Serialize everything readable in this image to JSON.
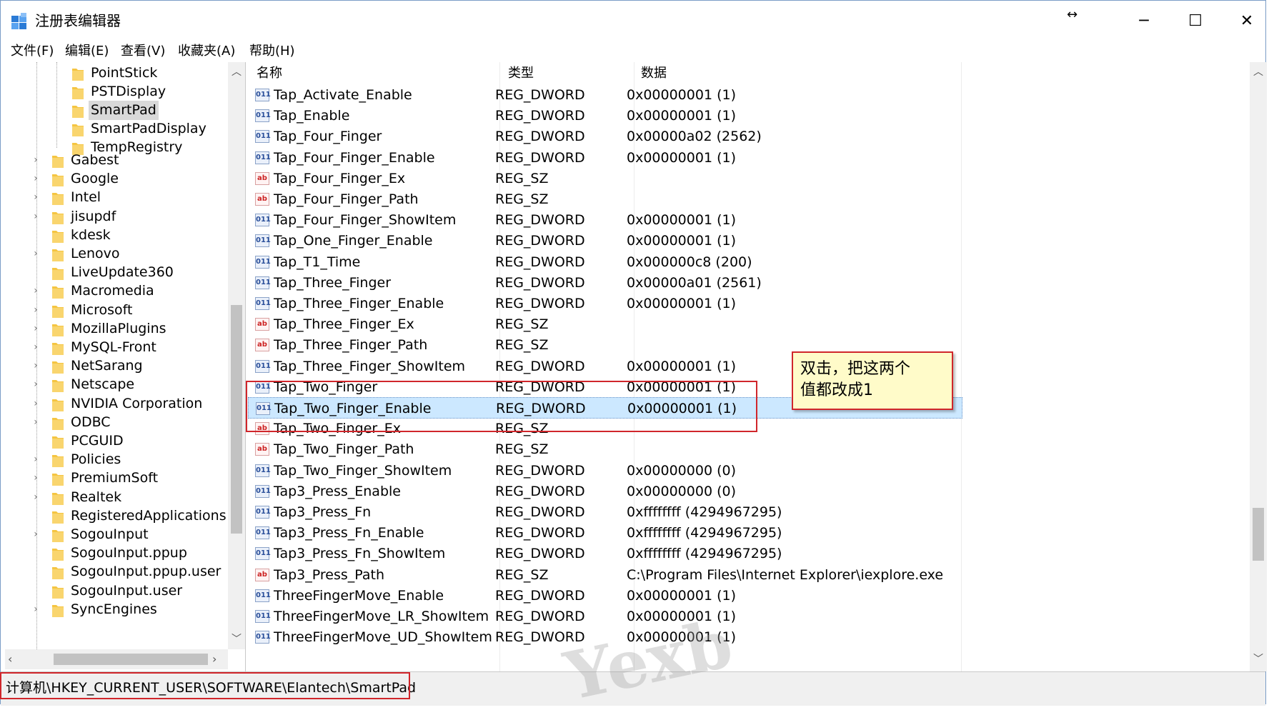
{
  "window": {
    "title": "注册表编辑器",
    "minimize_glyph": "─",
    "maximize_glyph": "☐",
    "close_glyph": "✕",
    "resize_hint": "↔"
  },
  "menu": [
    "文件(F)",
    "编辑(E)",
    "查看(V)",
    "收藏夹(A)",
    "帮助(H)"
  ],
  "tree": {
    "children_smartpad_parent": [
      "PointStick",
      "PSTDisplay",
      "SmartPad",
      "SmartPadDisplay",
      "TempRegistry"
    ],
    "selected": "SmartPad",
    "siblings": [
      "Gabest",
      "Google",
      "Intel",
      "jisupdf",
      "kdesk",
      "Lenovo",
      "LiveUpdate360",
      "Macromedia",
      "Microsoft",
      "MozillaPlugins",
      "MySQL-Front",
      "NetSarang",
      "Netscape",
      "NVIDIA Corporation",
      "ODBC",
      "PCGUID",
      "Policies",
      "PremiumSoft",
      "Realtek",
      "RegisteredApplications",
      "SogouInput",
      "SogouInput.ppup",
      "SogouInput.ppup.user",
      "SogouInput.user",
      "SyncEngines"
    ],
    "expandable": [
      true,
      true,
      true,
      true,
      false,
      true,
      false,
      true,
      true,
      true,
      true,
      true,
      true,
      true,
      true,
      false,
      true,
      true,
      true,
      false,
      true,
      false,
      false,
      false,
      true
    ]
  },
  "list": {
    "headers": {
      "name": "名称",
      "type": "类型",
      "data": "数据"
    },
    "rows": [
      {
        "name": "Tap_Activate_Enable",
        "type": "REG_DWORD",
        "data": "0x00000001 (1)",
        "icon": "dword"
      },
      {
        "name": "Tap_Enable",
        "type": "REG_DWORD",
        "data": "0x00000001 (1)",
        "icon": "dword"
      },
      {
        "name": "Tap_Four_Finger",
        "type": "REG_DWORD",
        "data": "0x00000a02 (2562)",
        "icon": "dword"
      },
      {
        "name": "Tap_Four_Finger_Enable",
        "type": "REG_DWORD",
        "data": "0x00000001 (1)",
        "icon": "dword"
      },
      {
        "name": "Tap_Four_Finger_Ex",
        "type": "REG_SZ",
        "data": "",
        "icon": "sz"
      },
      {
        "name": "Tap_Four_Finger_Path",
        "type": "REG_SZ",
        "data": "",
        "icon": "sz"
      },
      {
        "name": "Tap_Four_Finger_ShowItem",
        "type": "REG_DWORD",
        "data": "0x00000001 (1)",
        "icon": "dword"
      },
      {
        "name": "Tap_One_Finger_Enable",
        "type": "REG_DWORD",
        "data": "0x00000001 (1)",
        "icon": "dword"
      },
      {
        "name": "Tap_T1_Time",
        "type": "REG_DWORD",
        "data": "0x000000c8 (200)",
        "icon": "dword"
      },
      {
        "name": "Tap_Three_Finger",
        "type": "REG_DWORD",
        "data": "0x00000a01 (2561)",
        "icon": "dword"
      },
      {
        "name": "Tap_Three_Finger_Enable",
        "type": "REG_DWORD",
        "data": "0x00000001 (1)",
        "icon": "dword"
      },
      {
        "name": "Tap_Three_Finger_Ex",
        "type": "REG_SZ",
        "data": "",
        "icon": "sz"
      },
      {
        "name": "Tap_Three_Finger_Path",
        "type": "REG_SZ",
        "data": "",
        "icon": "sz"
      },
      {
        "name": "Tap_Three_Finger_ShowItem",
        "type": "REG_DWORD",
        "data": "0x00000001 (1)",
        "icon": "dword"
      },
      {
        "name": "Tap_Two_Finger",
        "type": "REG_DWORD",
        "data": "0x00000001 (1)",
        "icon": "dword"
      },
      {
        "name": "Tap_Two_Finger_Enable",
        "type": "REG_DWORD",
        "data": "0x00000001 (1)",
        "icon": "dword",
        "selected": true
      },
      {
        "name": "Tap_Two_Finger_Ex",
        "type": "REG_SZ",
        "data": "",
        "icon": "sz"
      },
      {
        "name": "Tap_Two_Finger_Path",
        "type": "REG_SZ",
        "data": "",
        "icon": "sz"
      },
      {
        "name": "Tap_Two_Finger_ShowItem",
        "type": "REG_DWORD",
        "data": "0x00000000 (0)",
        "icon": "dword"
      },
      {
        "name": "Tap3_Press_Enable",
        "type": "REG_DWORD",
        "data": "0x00000000 (0)",
        "icon": "dword"
      },
      {
        "name": "Tap3_Press_Fn",
        "type": "REG_DWORD",
        "data": "0xffffffff (4294967295)",
        "icon": "dword"
      },
      {
        "name": "Tap3_Press_Fn_Enable",
        "type": "REG_DWORD",
        "data": "0xffffffff (4294967295)",
        "icon": "dword"
      },
      {
        "name": "Tap3_Press_Fn_ShowItem",
        "type": "REG_DWORD",
        "data": "0xffffffff (4294967295)",
        "icon": "dword"
      },
      {
        "name": "Tap3_Press_Path",
        "type": "REG_SZ",
        "data": "C:\\Program Files\\Internet Explorer\\iexplore.exe",
        "icon": "sz"
      },
      {
        "name": "ThreeFingerMove_Enable",
        "type": "REG_DWORD",
        "data": "0x00000001 (1)",
        "icon": "dword"
      },
      {
        "name": "ThreeFingerMove_LR_ShowItem",
        "type": "REG_DWORD",
        "data": "0x00000001 (1)",
        "icon": "dword"
      },
      {
        "name": "ThreeFingerMove_UD_ShowItem",
        "type": "REG_DWORD",
        "data": "0x00000001 (1)",
        "icon": "dword"
      }
    ]
  },
  "status_path": "计算机\\HKEY_CURRENT_USER\\SOFTWARE\\Elantech\\SmartPad",
  "annotation": {
    "line1": "双击，把这两个",
    "line2": "值都改成1"
  },
  "watermark": "Yexb",
  "icons": {
    "dword_glyph": "011",
    "sz_glyph": "ab",
    "folder_color": "#f5c542",
    "selection_color": "#cce8ff",
    "annotation_border": "#d0262b"
  }
}
